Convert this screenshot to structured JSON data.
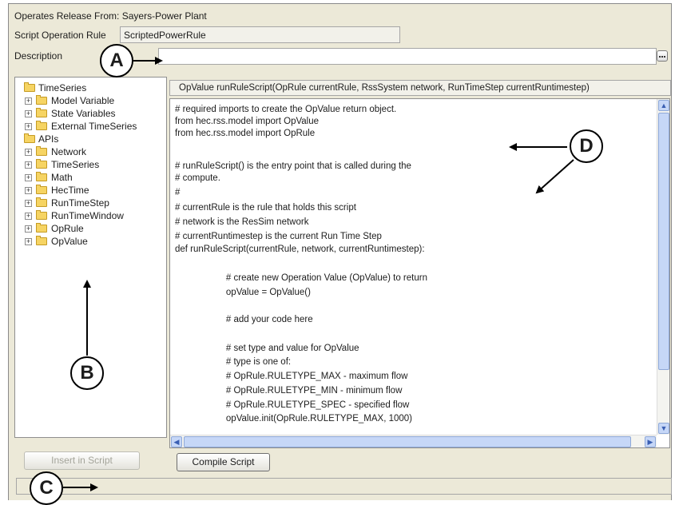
{
  "header": {
    "operates_release": "Operates Release From: Sayers-Power Plant",
    "rule_label": "Script Operation Rule",
    "rule_value": "ScriptedPowerRule",
    "description_label": "Description",
    "description_value": ""
  },
  "tree": {
    "items": [
      {
        "label": "TimeSeries",
        "expander": ""
      },
      {
        "label": "Model Variable",
        "expander": "+"
      },
      {
        "label": "State Variables",
        "expander": "+"
      },
      {
        "label": "External TimeSeries",
        "expander": "+"
      },
      {
        "label": "APIs",
        "expander": ""
      },
      {
        "label": "Network",
        "expander": "+"
      },
      {
        "label": "TimeSeries",
        "expander": "+"
      },
      {
        "label": "Math",
        "expander": "+"
      },
      {
        "label": "HecTime",
        "expander": "+"
      },
      {
        "label": "RunTimeStep",
        "expander": "+"
      },
      {
        "label": "RunTimeWindow",
        "expander": "+"
      },
      {
        "label": "OpRule",
        "expander": "+"
      },
      {
        "label": "OpValue",
        "expander": "+"
      }
    ]
  },
  "buttons": {
    "insert_in_script": "Insert in Script",
    "compile_script": "Compile Script"
  },
  "editor": {
    "signature": "OpValue runRuleScript(OpRule currentRule, RssSystem network, RunTimeStep currentRuntimestep)",
    "lines": [
      "# required imports to create the OpValue return object.",
      "from hec.rss.model import OpValue",
      "from hec.rss.model import OpRule",
      "",
      "# runRuleScript() is the entry point that is called during the",
      "# compute.",
      "#",
      "# currentRule is the rule that holds this script",
      "# network is the ResSim network",
      "# currentRuntimestep is the current Run Time Step",
      "def runRuleScript(currentRule, network, currentRuntimestep):",
      "",
      "                    # create new Operation Value (OpValue) to return",
      "                    opValue = OpValue()",
      "",
      "                    # add your code here",
      "",
      "                    # set type and value for OpValue",
      "                    # type is one of:",
      "                    # OpRule.RULETYPE_MAX - maximum flow",
      "                    # OpRule.RULETYPE_MIN - minimum flow",
      "                    # OpRule.RULETYPE_SPEC - specified flow",
      "                    opValue.init(OpRule.RULETYPE_MAX, 1000)"
    ]
  },
  "status_bar": {
    "text": ""
  },
  "callouts": {
    "a": "A",
    "b": "B",
    "c": "C",
    "d": "D"
  },
  "icons": {
    "folder": "folder-icon",
    "expand": "plus-box-icon",
    "ellipsis": "ellipsis-button-icon",
    "scroll_up": "scroll-up-arrow-icon",
    "scroll_down": "scroll-down-arrow-icon",
    "scroll_left": "scroll-left-arrow-icon",
    "scroll_right": "scroll-right-arrow-icon"
  },
  "colors": {
    "window_bg": "#ece9d8",
    "scroll_accent": "#c6d7f7",
    "folder": "#f6d463"
  }
}
